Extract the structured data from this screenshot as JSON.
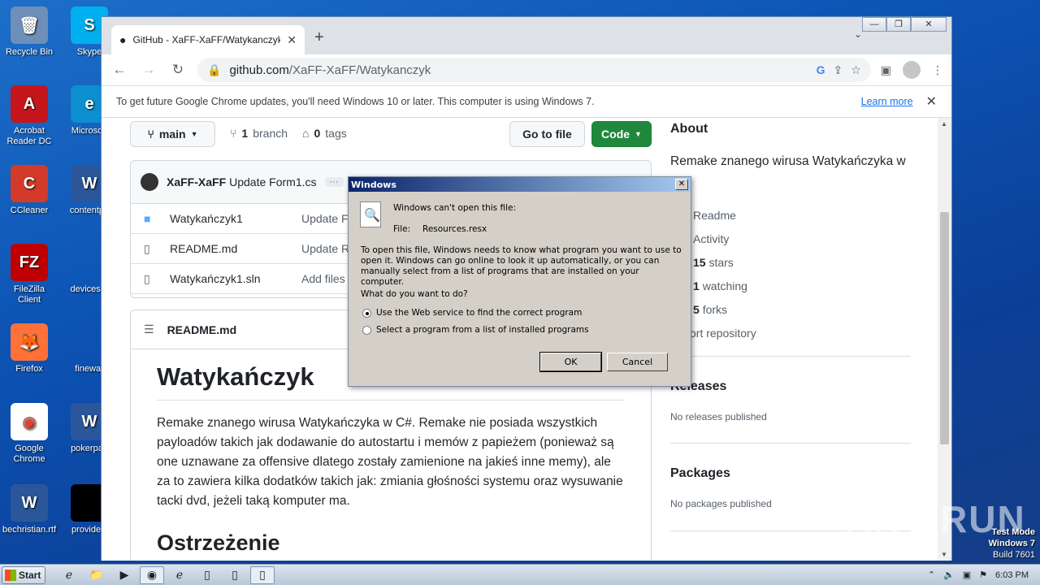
{
  "desktop": {
    "icons": [
      {
        "label": "Recycle Bin",
        "glyph": "🗑",
        "color": "#6e8fb8"
      },
      {
        "label": "Skype",
        "glyph": "S",
        "color": "#00aff0"
      },
      {
        "label": "Acrobat Reader DC",
        "glyph": "A",
        "color": "#c4161c"
      },
      {
        "label": "Microsoft",
        "glyph": "e",
        "color": "#0c8fcf"
      },
      {
        "label": "CCleaner",
        "glyph": "C",
        "color": "#d23a2a"
      },
      {
        "label": "contentpa",
        "glyph": "W",
        "color": "#2b579a"
      },
      {
        "label": "FileZilla Client",
        "glyph": "FZ",
        "color": "#bf0000"
      },
      {
        "label": "devicespr",
        "glyph": "",
        "color": "transparent"
      },
      {
        "label": "Firefox",
        "glyph": "🦊",
        "color": "#ff7139"
      },
      {
        "label": "finewar",
        "glyph": "",
        "color": "transparent"
      },
      {
        "label": "Google Chrome",
        "glyph": "◉",
        "color": "#ffffff"
      },
      {
        "label": "pokerpan",
        "glyph": "W",
        "color": "#2b579a"
      },
      {
        "label": "bechristian.rtf",
        "glyph": "W",
        "color": "#2b579a"
      },
      {
        "label": "providefil",
        "glyph": "",
        "color": "#000000"
      }
    ]
  },
  "browser": {
    "tab_title": "GitHub - XaFF-XaFF/Watykanczyk: R",
    "new_tab": "+",
    "tab_list": "⌄",
    "win_min": "—",
    "win_max": "❐",
    "win_close": "✕",
    "url_host": "github.com",
    "url_path": "/XaFF-XaFF/Watykanczyk",
    "infobar_msg": "To get future Google Chrome updates, you'll need Windows 10 or later. This computer is using Windows 7.",
    "infobar_link": "Learn more"
  },
  "repo": {
    "branch_label": "main",
    "branch_count": "1",
    "branch_word": "branch",
    "tag_count": "0",
    "tag_word": "tags",
    "goto_file": "Go to file",
    "code_button": "Code",
    "commit_author": "XaFF-XaFF",
    "commit_msg": "Update Form1.cs",
    "commit_more": "···",
    "files": [
      {
        "type": "dir",
        "name": "Watykańczyk1",
        "msg": "Update F"
      },
      {
        "type": "file",
        "name": "README.md",
        "msg": "Update R"
      },
      {
        "type": "file",
        "name": "Watykańczyk1.sln",
        "msg": "Add files"
      }
    ],
    "readme_file": "README.md",
    "readme_h1": "Watykańczyk",
    "readme_p": "Remake znanego wirusa Watykańczyka w C#. Remake nie posiada wszystkich payloadów takich jak dodawanie do autostartu i memów z papieżem (ponieważ są one uznawane za offensive dlatego zostały zamienione na jakieś inne memy), ale za to zawiera kilka dodatków takich jak: zmiania głośności systemu oraz wysuwanie tacki dvd, jeżeli taką komputer ma.",
    "readme_h2": "Ostrzeżenie"
  },
  "about": {
    "heading": "About",
    "description": "Remake znanego wirusa Watykańczyka w",
    "readme": "Readme",
    "activity": "Activity",
    "stars_count": "15",
    "stars_word": "stars",
    "watching_count": "1",
    "watching_word": "watching",
    "forks_count": "5",
    "forks_word": "forks",
    "report": "ort repository",
    "releases_heading": "Releases",
    "releases_none": "No releases published",
    "packages_heading": "Packages",
    "packages_none": "No packages published"
  },
  "dialog": {
    "title": "Windows",
    "close": "✕",
    "cant_open": "Windows can't open this file:",
    "file_label": "File:",
    "file_name": "Resources.resx",
    "explanation": "To open this file, Windows needs to know what program you want to use to open it. Windows can go online to look it up automatically, or you can manually select from a list of programs that are installed on your computer.",
    "question": "What do you want to do?",
    "option_web": "Use the Web service to find the correct program",
    "option_list": "Select a program from a list of installed programs",
    "ok": "OK",
    "cancel": "Cancel"
  },
  "taskbar": {
    "start": "Start",
    "clock": "6:03 PM"
  },
  "overlay": {
    "watermark": "ANY RUN",
    "test_mode": "Test Mode",
    "os": "Windows 7",
    "build": "Build 7601"
  }
}
